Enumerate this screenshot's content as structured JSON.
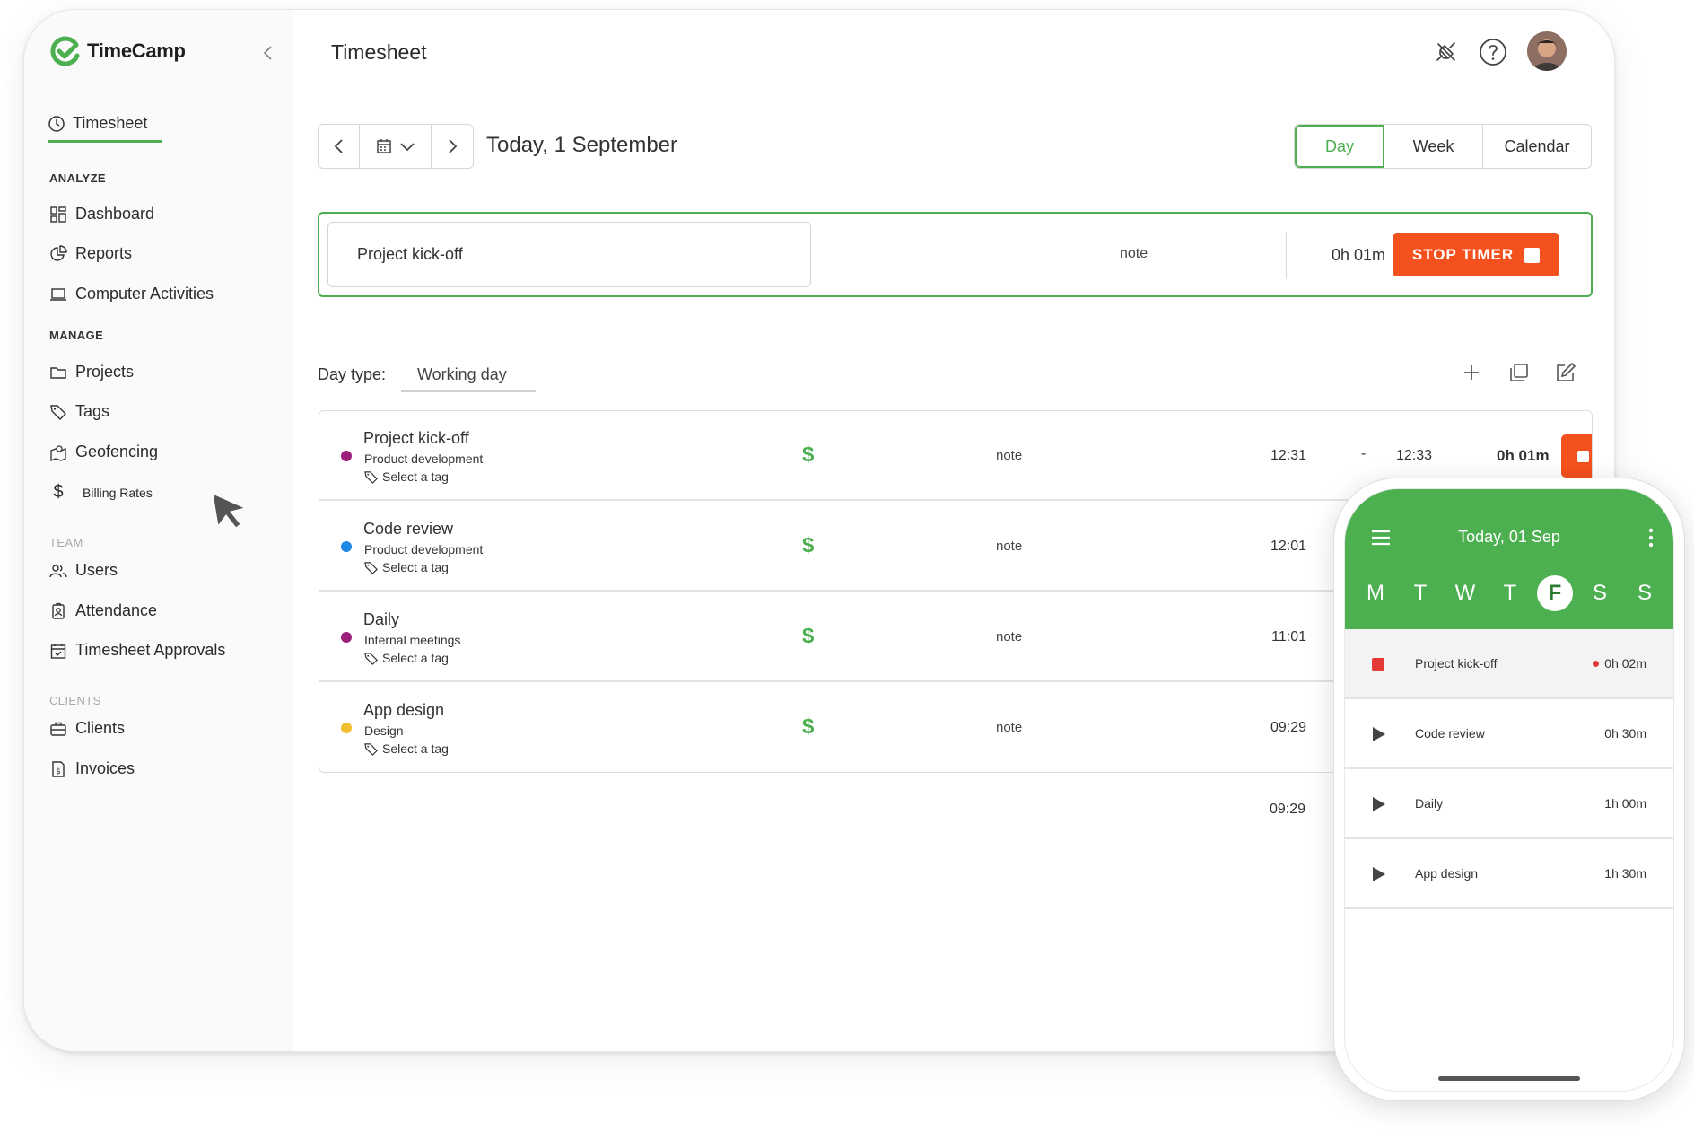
{
  "app": {
    "brand": "TimeCamp",
    "page_title": "Timesheet",
    "accent": "#4caf50",
    "danger": "#f4511e"
  },
  "sidebar": {
    "active": {
      "label": "Timesheet",
      "icon": "clock-icon"
    },
    "sections": [
      {
        "title": "ANALYZE",
        "items": [
          {
            "label": "Dashboard",
            "icon": "dashboard-icon"
          },
          {
            "label": "Reports",
            "icon": "pie-chart-icon"
          },
          {
            "label": "Computer Activities",
            "icon": "laptop-icon"
          }
        ]
      },
      {
        "title": "MANAGE",
        "items": [
          {
            "label": "Projects",
            "icon": "folder-icon"
          },
          {
            "label": "Tags",
            "icon": "tag-icon"
          },
          {
            "label": "Geofencing",
            "icon": "map-pin-icon"
          },
          {
            "label": "Billing Rates",
            "icon": "dollar-icon"
          }
        ]
      },
      {
        "title": "TEAM",
        "items": [
          {
            "label": "Users",
            "icon": "users-icon"
          },
          {
            "label": "Attendance",
            "icon": "badge-icon"
          },
          {
            "label": "Timesheet Approvals",
            "icon": "calendar-check-icon"
          }
        ]
      },
      {
        "title": "CLIENTS",
        "items": [
          {
            "label": "Clients",
            "icon": "briefcase-icon"
          },
          {
            "label": "Invoices",
            "icon": "invoice-icon"
          }
        ]
      }
    ]
  },
  "toolbar": {
    "date_label": "Today, 1 September",
    "views": [
      "Day",
      "Week",
      "Calendar"
    ],
    "active_view": "Day"
  },
  "timer": {
    "task": "Project kick-off",
    "note": "note",
    "duration": "0h 01m",
    "stop_label": "STOP TIMER"
  },
  "day_type": {
    "label": "Day type:",
    "value": "Working day"
  },
  "entries": [
    {
      "title": "Project kick-off",
      "project": "Product development",
      "tag": "Select a tag",
      "dot_color": "#9c1f7a",
      "billable": "$",
      "note": "note",
      "start": "12:31",
      "dash": "-",
      "end": "12:33",
      "duration": "0h 01m",
      "running": true
    },
    {
      "title": "Code review",
      "project": "Product development",
      "tag": "Select a tag",
      "dot_color": "#1e88e5",
      "billable": "$",
      "note": "note",
      "start": "12:01"
    },
    {
      "title": "Daily",
      "project": "Internal meetings",
      "tag": "Select a tag",
      "dot_color": "#9c1f7a",
      "billable": "$",
      "note": "note",
      "start": "11:01"
    },
    {
      "title": "App design",
      "project": "Design",
      "tag": "Select a tag",
      "dot_color": "#f2c02e",
      "billable": "$",
      "note": "note",
      "start": "09:29"
    }
  ],
  "total": "09:29",
  "mobile": {
    "date": "Today, 01 Sep",
    "days": [
      "M",
      "T",
      "W",
      "T",
      "F",
      "S",
      "S"
    ],
    "selected_day": "F",
    "rows": [
      {
        "label": "Project kick-off",
        "time": "0h 02m",
        "running": true
      },
      {
        "label": "Code review",
        "time": "0h 30m"
      },
      {
        "label": "Daily",
        "time": "1h 00m"
      },
      {
        "label": "App design",
        "time": "1h 30m"
      }
    ]
  }
}
